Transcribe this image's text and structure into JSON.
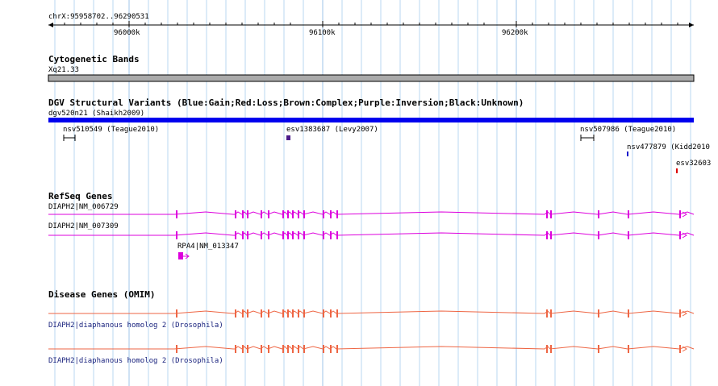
{
  "ruler": {
    "range_label": "chrX:95958702..96290531",
    "ticks": [
      "96000k",
      "96100k",
      "96200k"
    ]
  },
  "cytoband": {
    "title": "Cytogenetic Bands",
    "band_label": "Xq21.33"
  },
  "dgv": {
    "title": "DGV Structural Variants (Blue:Gain;Red:Loss;Brown:Complex;Purple:Inversion;Black:Unknown)",
    "bar_label": "dgv520n21 (Shaikh2009)",
    "features": [
      {
        "label": "nsv510549 (Teague2010)",
        "color": "#000000"
      },
      {
        "label": "esv1383687 (Levy2007)",
        "color": "#4b1a8a"
      },
      {
        "label": "nsv507986 (Teague2010)",
        "color": "#000000"
      },
      {
        "label": "nsv477879 (Kidd2010",
        "color": "#1a1acc"
      },
      {
        "label": "esv32603",
        "color": "#dd0000"
      }
    ],
    "bar_color": "#0000ee"
  },
  "refseq": {
    "title": "RefSeq Genes",
    "genes": [
      {
        "label": "DIAPH2|NM_006729",
        "color": "#dd00dd"
      },
      {
        "label": "DIAPH2|NM_007309",
        "color": "#dd00dd"
      },
      {
        "label": "RPA4|NM_013347",
        "color": "#dd00dd"
      }
    ]
  },
  "omim": {
    "title": "Disease Genes (OMIM)",
    "genes": [
      {
        "label": "DIAPH2|diaphanous homolog 2 (Drosophila)",
        "color": "#ee6644"
      },
      {
        "label": "DIAPH2|diaphanous homolog 2 (Drosophila)",
        "color": "#ee6644"
      }
    ]
  },
  "colors": {
    "grid_line": "#b9d7f0",
    "cytoband_fill": "#aaaaaa"
  }
}
